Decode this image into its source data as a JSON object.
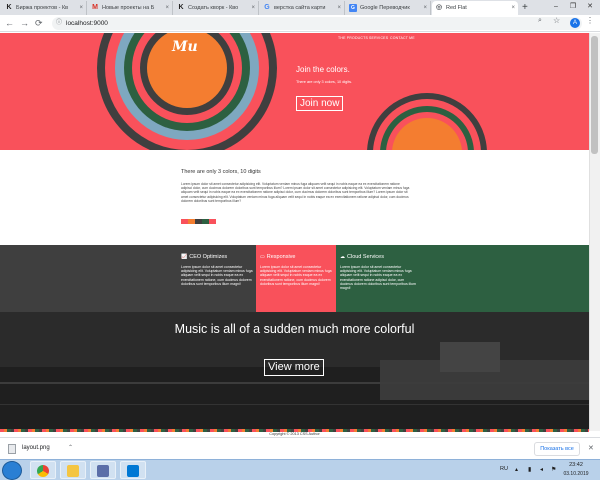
{
  "browser": {
    "tabs": [
      {
        "label": "Биржа проектов - Кв",
        "icon": "k-icon"
      },
      {
        "label": "Новые проекты на Б",
        "icon": "gmail-icon"
      },
      {
        "label": "Создать кворк - Кво",
        "icon": "k-icon"
      },
      {
        "label": "верстка сайта карти",
        "icon": "google-icon"
      },
      {
        "label": "Google Переводчик",
        "icon": "translate-icon"
      },
      {
        "label": "Red Flat",
        "icon": "globe-icon"
      }
    ],
    "url": "localhost:9000"
  },
  "site": {
    "logo": "Mu",
    "nav": [
      "THE PRODUCTS",
      "SERVICES",
      "CONTACT ME"
    ],
    "hero": {
      "title": "Join the colors.",
      "subtitle": "There are only 3 colors, 10 digits.",
      "button": "Join now"
    },
    "info": {
      "title": "There are only 3 colors, 10 digits",
      "text": "Lorem ipsum dolor sit amet consectetur adipisicing elit. Voluptatum veniam minus fuga aliquam velit sequi in nobis eaque ea ex exercitationem ratione adipisci dolor, cum ducimus dolorem doloribus sunt temporibus illum? Lorem ipsum dolor sit amet consectetur adipisicing elit. Voluptatum veniam minus fuga aliquam velit sequi in nobis eaque ea ex exercitationem ratione adipisci dolor, cum ducimus dolorem doloribus sunt temporibus illum? Lorem ipsum dolor sit amet consectetur adipisicing elit. Voluptatum veniam minus fuga aliquam velit sequi in nobis eaque ea ex exercitationem ratione adipisci dolor, cum ducimus dolorem doloribus sunt temporibus illum?",
      "swatches": [
        "#f9515b",
        "#f47d30",
        "#3f3f3f",
        "#2d6041",
        "#f9515b"
      ]
    },
    "features": [
      {
        "title": "CEO Optimizes",
        "icon": "chart-icon",
        "bg": "#3f3f3f",
        "text": "Lorem ipsum dolor sit amet consectetur adipisicing elit. Voluptatum veniam minus fuga aliquam velit sequi in nobis eaque ea ex exercitationem ratione, cum ducimus dolorem doloribus sunt temporibus illum magni!"
      },
      {
        "title": "Responsive",
        "icon": "laptop-icon",
        "bg": "#f9515b",
        "text": "Lorem ipsum dolor sit amet consectetur adipisicing elit. Voluptatum veniam minus fuga aliquam velit sequi in nobis eaque ea ex exercitationem ratione, cum ducimus dolorem doloribus sunt temporibus illum magni!"
      },
      {
        "title": "Cloud Services",
        "icon": "cloud-icon",
        "bg": "#2d6041",
        "text": "Lorem ipsum dolor sit amet consectetur adipisicing elit. Voluptatum veniam minus fuga aliquam velit sequi in nobis eaque ea ex exercitationem ratione adipisci dolor, cum ducimus dolorem doloribus sunt temporibus illum magni!"
      }
    ],
    "music": {
      "title": "Music is all of a sudden much more colorful",
      "button": "View more"
    },
    "footer": "Copyright © 2013 CSS Author"
  },
  "downloads": {
    "file": "layout.png",
    "show_all": "Показать все"
  },
  "taskbar": {
    "lang": "RU",
    "time": "23:42",
    "date": "03.10.2019"
  },
  "colors": {
    "red": "#f9515b",
    "orange": "#f47d30",
    "dark": "#3f3f3f",
    "green": "#2d6041",
    "blue": "#7ea8c0"
  }
}
